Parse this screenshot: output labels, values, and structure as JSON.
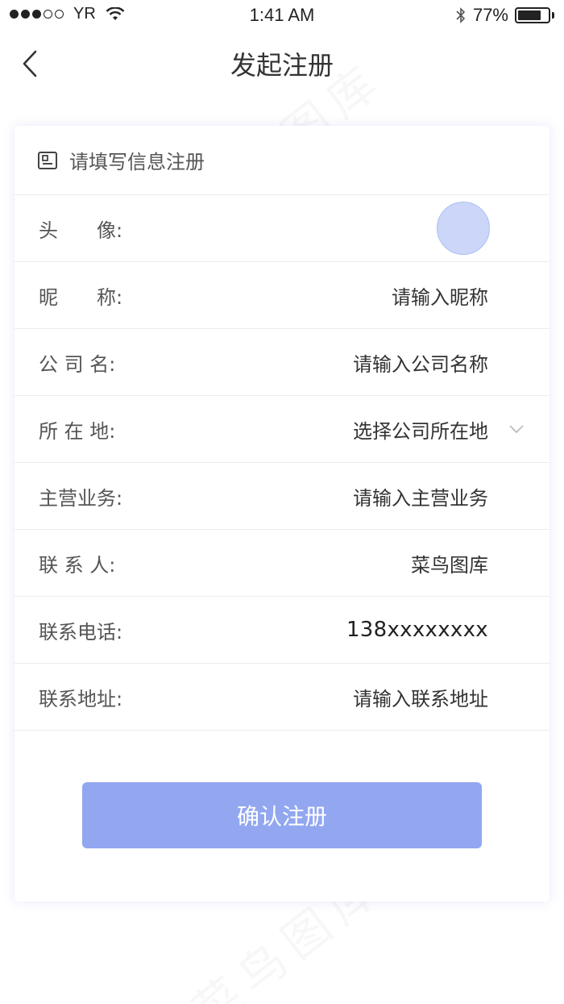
{
  "status_bar": {
    "carrier": "YR",
    "time": "1:41 AM",
    "battery": "77%",
    "battery_level": 0.77
  },
  "nav": {
    "title": "发起注册",
    "back_icon": "chevron-left-icon"
  },
  "form": {
    "header": "请填写信息注册",
    "header_icon": "id-card-icon",
    "rows": [
      {
        "label": "头　　像:",
        "value": ""
      },
      {
        "label": "昵　　称:",
        "value": "请输入昵称"
      },
      {
        "label": "公 司 名:",
        "value": "请输入公司名称"
      },
      {
        "label": "所 在 地:",
        "value": "选择公司所在地"
      },
      {
        "label": "主营业务:",
        "value": "请输入主营业务"
      },
      {
        "label": "联 系 人:",
        "value": "菜鸟图库"
      },
      {
        "label": "联系电话:",
        "value": "138xxxxxxxx"
      },
      {
        "label": "联系地址:",
        "value": "请输入联系地址"
      }
    ],
    "dropdown_icon": "chevron-down-icon",
    "submit_label": "确认注册"
  },
  "watermark": "菜鸟图库",
  "colors": {
    "accent": "#92a7f0",
    "avatar": "#cbd6f8",
    "divider": "#ececec"
  }
}
